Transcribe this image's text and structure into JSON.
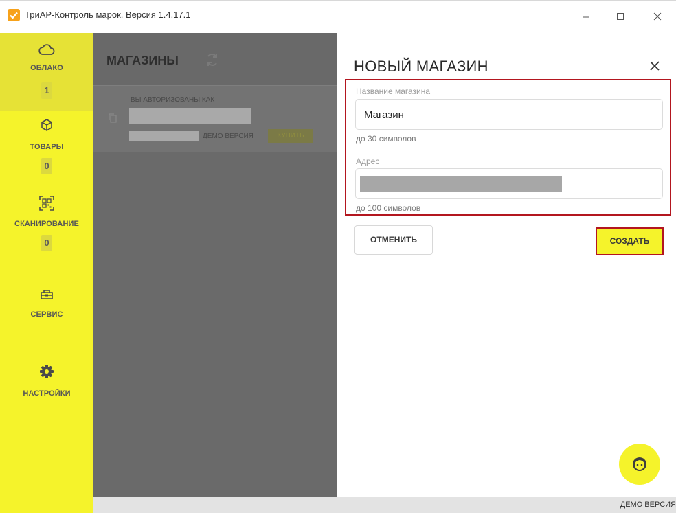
{
  "window": {
    "title": "ТриАР-Контроль марок. Версия 1.4.17.1",
    "icons": {
      "app": "checkbox-icon",
      "minimize": "minimize-icon",
      "maximize": "maximize-icon",
      "close": "close-icon"
    }
  },
  "sidebar": {
    "items": [
      {
        "label": "ОБЛАКО",
        "icon": "cloud-icon",
        "badge": "1",
        "active": true
      },
      {
        "label": "ТОВАРЫ",
        "icon": "box-icon",
        "badge": "0"
      },
      {
        "label": "СКАНИРОВАНИЕ",
        "icon": "qr-scan-icon",
        "badge": "0"
      },
      {
        "label": "СЕРВИС",
        "icon": "toolbox-icon"
      },
      {
        "label": "НАСТРОЙКИ",
        "icon": "gear-icon"
      }
    ]
  },
  "page": {
    "title": "МАГАЗИНЫ",
    "account_label": "ВЫ АВТОРИЗОВАНЫ КАК",
    "demo_label": "ДЕМО ВЕРСИЯ",
    "buy_label": "КУПИТЬ"
  },
  "dialog": {
    "title": "НОВЫЙ МАГАЗИН",
    "name_field": {
      "label": "Название магазина",
      "value": "Магазин",
      "hint": "до 30 символов"
    },
    "address_field": {
      "label": "Адрес",
      "hint": "до 100 символов"
    },
    "cancel_label": "ОТМЕНИТЬ",
    "create_label": "СОЗДАТЬ"
  },
  "statusbar": {
    "text": "ДЕМО ВЕРСИЯ"
  },
  "colors": {
    "accent": "#f5f32b",
    "highlight": "#b3161f",
    "overlay": "#6a6a6a",
    "app_icon": "#f7a21b"
  }
}
